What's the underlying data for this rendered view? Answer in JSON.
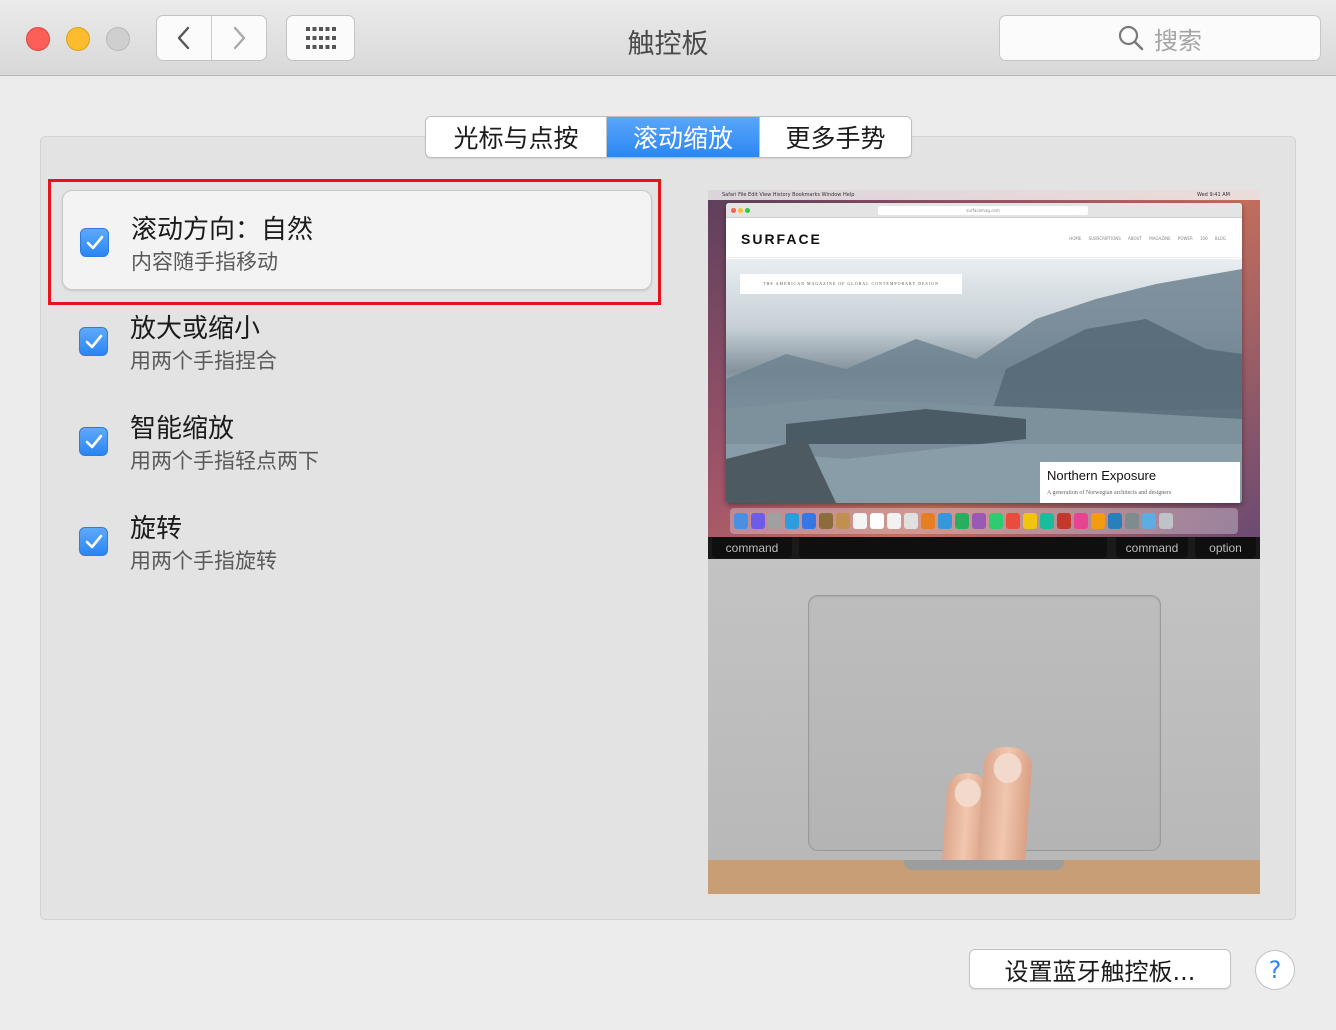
{
  "window": {
    "title": "触控板",
    "search_placeholder": "搜索"
  },
  "tabs": [
    {
      "label": "光标与点按",
      "selected": false
    },
    {
      "label": "滚动缩放",
      "selected": true
    },
    {
      "label": "更多手势",
      "selected": false
    }
  ],
  "options": [
    {
      "title": "滚动方向：自然",
      "subtitle": "内容随手指移动",
      "checked": true,
      "selected": true
    },
    {
      "title": "放大或缩小",
      "subtitle": "用两个手指捏合",
      "checked": true,
      "selected": false
    },
    {
      "title": "智能缩放",
      "subtitle": "用两个手指轻点两下",
      "checked": true,
      "selected": false
    },
    {
      "title": "旋转",
      "subtitle": "用两个手指旋转",
      "checked": true,
      "selected": false
    }
  ],
  "preview": {
    "menubar_items": "Safari   File   Edit   View   History   Bookmarks   Window   Help",
    "menubar_time": "Wed 9:41 AM",
    "url": "surfacemag.com",
    "site_logo": "SURFACE",
    "site_nav": "HOME SUBSCRIPTIONS ABOUT MAGAZINE POWER 100 BLOG",
    "hero_tagline": "THE AMERICAN MAGAZINE OF GLOBAL CONTEMPORARY DESIGN",
    "caption_title": "Northern Exposure",
    "caption_subtitle": "A generation of Norwegian architects and designers",
    "keys": [
      "command",
      "command",
      "option"
    ]
  },
  "footer": {
    "bluetooth_button": "设置蓝牙触控板...",
    "help_label": "?"
  },
  "colors": {
    "accent": "#2b87f3",
    "highlight_border": "#e5141c",
    "close": "#fc5f57",
    "minimize": "#fdbc2e",
    "zoom": "#cfcfcf"
  }
}
